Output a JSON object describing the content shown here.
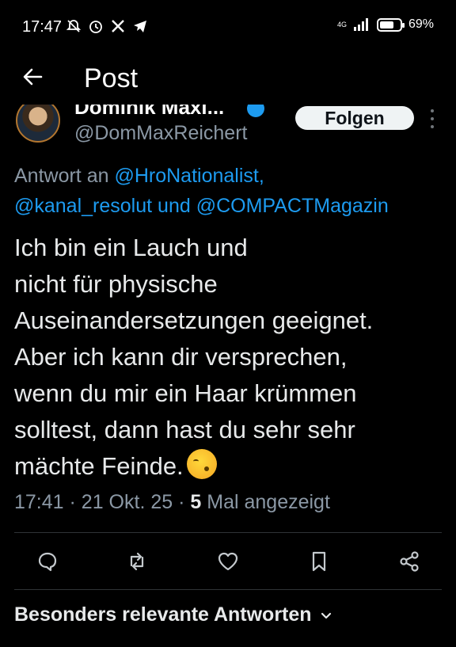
{
  "status_bar": {
    "time": "17:47",
    "network": "4G",
    "battery": "69%",
    "battery_level": 0.69
  },
  "header": {
    "title": "Post"
  },
  "author": {
    "display_name": "Dominik Maxi...",
    "handle": "@DomMaxReichert",
    "follow_label": "Folgen"
  },
  "reply_to": {
    "prefix": "Antwort an",
    "mention_1": "@HroNationalist,",
    "mention_2": "@kanal_resolut",
    "connector": "und",
    "mention_3": "@COMPACTMagazin"
  },
  "tweet": {
    "lines": [
      "Ich bin ein Lauch und",
      "nicht für physische",
      "Auseinandersetzungen geeignet.",
      "Aber ich kann dir versprechen,",
      "wenn du mir ein Haar krümmen",
      "solltest, dann hast du sehr sehr",
      "mächte Feinde."
    ],
    "emoji": "kissing-face-with-closed-eyes"
  },
  "meta": {
    "time": "17:41",
    "date": "21 Okt. 25",
    "views_count": "5",
    "views_label": "Mal angezeigt",
    "separator": "·"
  },
  "replies": {
    "label": "Besonders relevante Antworten"
  },
  "colors": {
    "background": "#000000",
    "text": "#e7e9ea",
    "secondary": "#8b98a5",
    "link": "#1d9bf0",
    "divider": "#2f3336"
  }
}
